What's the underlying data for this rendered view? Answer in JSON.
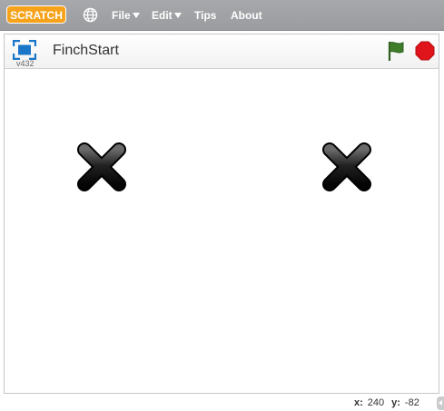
{
  "app": {
    "logo_text": "SCRATCH"
  },
  "menu": {
    "file": "File",
    "edit": "Edit",
    "tips": "Tips",
    "about": "About"
  },
  "stage": {
    "version": "v432",
    "project_title": "FinchStart",
    "sprites": [
      {
        "name": "x-mark-icon"
      },
      {
        "name": "x-mark-icon"
      }
    ]
  },
  "coords": {
    "x_label": "x:",
    "x_value": "240",
    "y_label": "y:",
    "y_value": "-82"
  },
  "colors": {
    "menubar": "#9c9ea1",
    "logo": "#f6a31b",
    "flag": "#3f7d2a",
    "stop": "#e0141b",
    "present": "#1a76c9"
  }
}
